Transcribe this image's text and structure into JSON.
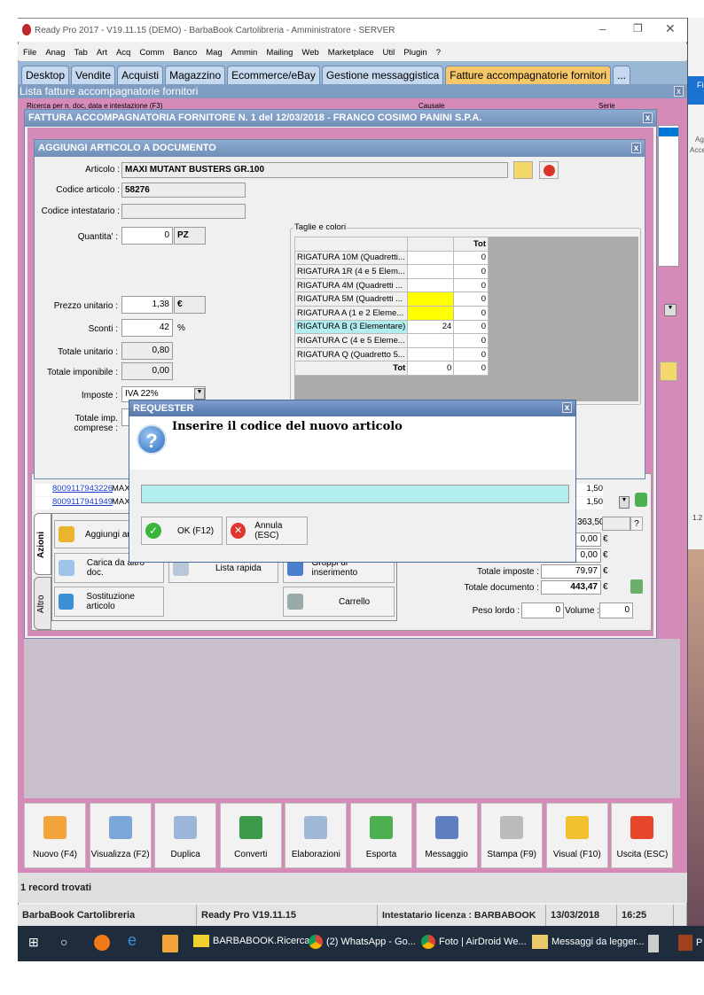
{
  "window": {
    "title": "Ready Pro 2017 - V19.11.15 (DEMO)  - BarbaBook Cartolibreria - Amministratore - SERVER"
  },
  "menu": [
    "File",
    "Anag",
    "Tab",
    "Art",
    "Acq",
    "Comm",
    "Banco",
    "Mag",
    "Ammin",
    "Mailing",
    "Web",
    "Marketplace",
    "Util",
    "Plugin",
    "?"
  ],
  "tabs": [
    "Desktop",
    "Vendite",
    "Acquisti",
    "Magazzino",
    "Ecommerce/eBay",
    "Gestione messaggistica",
    "Fatture accompagnatorie fornitori",
    "..."
  ],
  "list": {
    "title": "Lista fatture accompagnatorie fornitori",
    "search_label": "Ricerca per n. doc, data e intestazione (F3)",
    "causale_label": "Causale",
    "serie_label": "Serie"
  },
  "doc": {
    "title": "FATTURA ACCOMPAGNATORIA FORNITORE N. 1 del 12/03/2018 - FRANCO COSIMO PANINI S.P.A.",
    "rows": [
      {
        "code": "8009117943226",
        "desc": "MAXI",
        "price": "1,50"
      },
      {
        "code": "8009117941949",
        "desc": "MAXI",
        "price": "1,50"
      }
    ],
    "totals": {
      "v1": "363,50",
      "v2": "0,00",
      "v3": "0,00",
      "imposte_label": "Totale imposte :",
      "imposte": "79,97",
      "documento_label": "Totale documento :",
      "documento": "443,47",
      "currency": "€",
      "peso_label": "Peso lordo :",
      "peso": "0",
      "volume_label": "Volume :",
      "volume": "0",
      "help": "?"
    },
    "side_tabs": [
      "Azioni",
      "Altro"
    ],
    "actions": [
      "Aggiungi articolo",
      "Carica da altro doc.",
      "Lista rapida",
      "Gruppi di inserimento",
      "Sostituzione articolo",
      "Carrello"
    ]
  },
  "add": {
    "title": "AGGIUNGI ARTICOLO A DOCUMENTO",
    "articolo_label": "Articolo :",
    "articolo": "MAXI MUTANT BUSTERS GR.100",
    "codice_label": "Codice articolo :",
    "codice": "58276",
    "intest_label": "Codice intestatario :",
    "intest": "",
    "qta_label": "Quantita' :",
    "qta": "0",
    "um": "PZ",
    "prezzo_label": "Prezzo unitario :",
    "prezzo": "1,38",
    "valuta": "€",
    "sconti_label": "Sconti :",
    "sconti": "42",
    "perc": "%",
    "tot_unit_label": "Totale unitario :",
    "tot_unit": "0,80",
    "tot_imp_label": "Totale imponibile :",
    "tot_imp": "0,00",
    "imposte_label": "Imposte :",
    "imposte": "IVA 22%",
    "tot_comp_label": "Totale imp. comprese :",
    "taglie": {
      "legend": "Taglie e colori",
      "header_tot": "Tot",
      "rows": [
        {
          "n": "RIGATURA 10M (Quadretti...",
          "v": "",
          "t": "0"
        },
        {
          "n": "RIGATURA 1R (4 e 5 Elem...",
          "v": "",
          "t": "0"
        },
        {
          "n": "RIGATURA 4M (Quadretti ...",
          "v": "",
          "t": "0"
        },
        {
          "n": "RIGATURA 5M (Quadretti ...",
          "v": "",
          "t": "0"
        },
        {
          "n": "RIGATURA A (1 e 2 Eleme...",
          "v": "",
          "t": "0"
        },
        {
          "n": "RIGATURA B (3 Elementare)",
          "v": "24",
          "t": "0"
        },
        {
          "n": "RIGATURA C (4 e 5 Eleme...",
          "v": "",
          "t": "0"
        },
        {
          "n": "RIGATURA Q (Quadretto 5...",
          "v": "",
          "t": "0"
        }
      ],
      "footer": {
        "n": "Tot",
        "v": "0",
        "t": "0"
      }
    }
  },
  "requester": {
    "title": "REQUESTER",
    "message": "Inserire il codice del nuovo articolo",
    "input": "",
    "ok": "OK (F12)",
    "cancel": "Annula (ESC)"
  },
  "bottom_buttons": [
    "Nuovo (F4)",
    "Visualizza (F2)",
    "Duplica",
    "Converti",
    "Elaborazioni",
    "Esporta",
    "Messaggio",
    "Stampa (F9)",
    "Visual (F10)",
    "Uscita (ESC)"
  ],
  "records": "1 record trovati",
  "statusbar": {
    "company": "BarbaBook Cartolibreria",
    "version": "Ready Pro V19.11.15",
    "license": "Intestatario licenza : BARBABOOK CARTOLI",
    "date": "13/03/2018",
    "time": "16:25"
  },
  "taskbar": [
    "BARBABOOK.Ricerca",
    "(2) WhatsApp - Go...",
    "Foto | AirDroid We...",
    "Messaggi da legger...",
    "P"
  ],
  "right_window": {
    "text1": "Fi",
    "text2": "Ag",
    "text3": "Acce",
    "text4": "1.2"
  }
}
